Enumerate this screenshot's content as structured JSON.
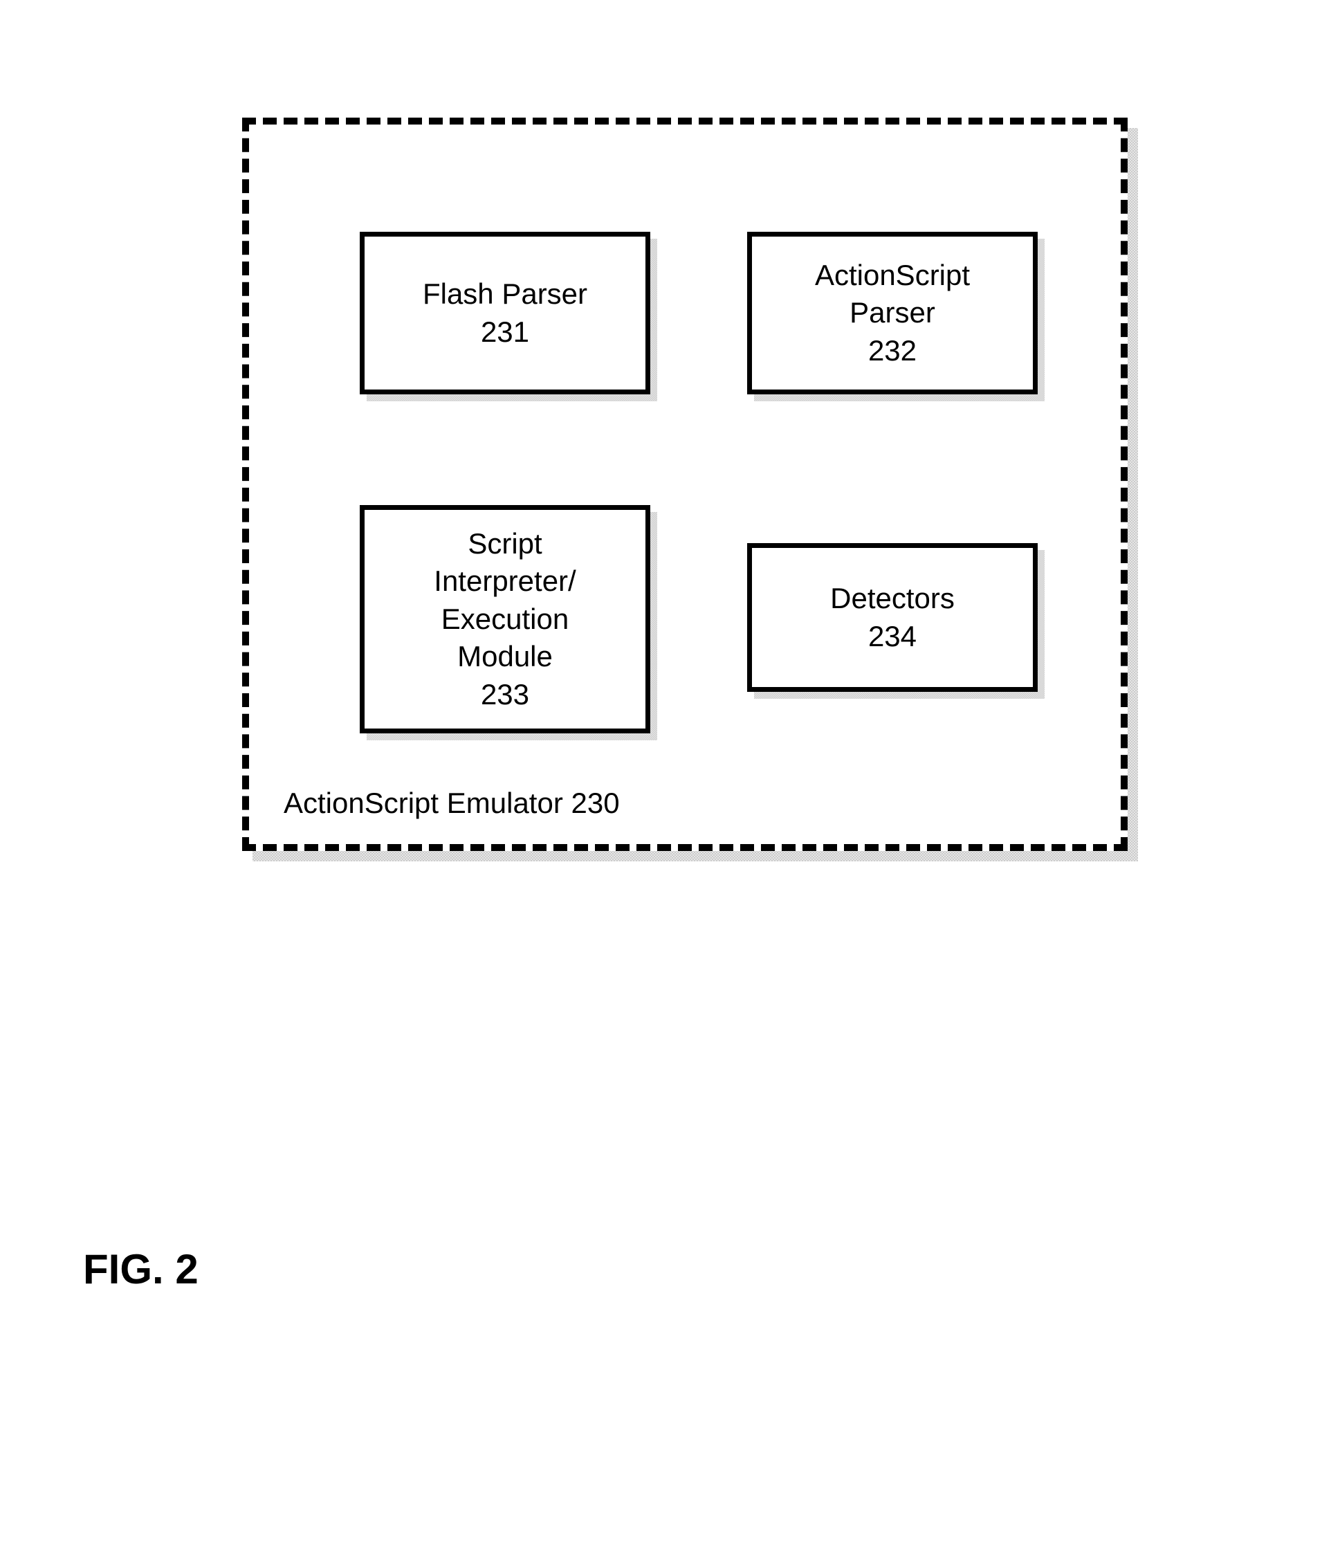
{
  "container": {
    "label": "ActionScript Emulator 230"
  },
  "boxes": {
    "flashParser": {
      "line1": "Flash Parser",
      "line2": "231"
    },
    "actionScriptParser": {
      "line1": "ActionScript",
      "line2": "Parser",
      "line3": "232"
    },
    "scriptInterpreter": {
      "line1": "Script",
      "line2": "Interpreter/",
      "line3": "Execution",
      "line4": "Module",
      "line5": "233"
    },
    "detectors": {
      "line1": "Detectors",
      "line2": "234"
    }
  },
  "figure": {
    "label": "FIG. 2"
  }
}
